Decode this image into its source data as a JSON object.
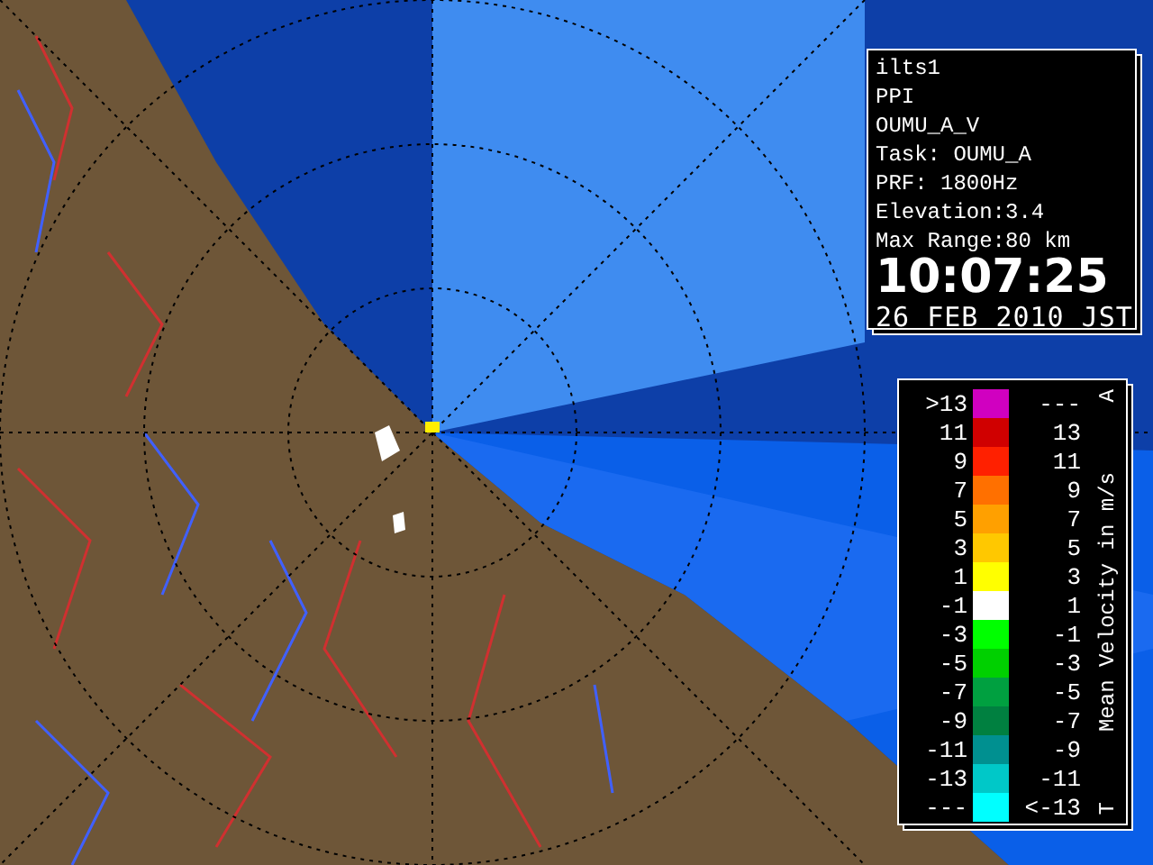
{
  "info": {
    "lines": [
      "ilts1",
      "PPI",
      "OUMU_A_V",
      "Task: OUMU_A",
      "PRF: 1800Hz",
      "Elevation:3.4",
      "Max Range:80 km"
    ],
    "time": "10:07:25",
    "date": "26 FEB 2010 JST"
  },
  "legend": {
    "title": "Mean Velocity in m/s",
    "top_mark": "A",
    "bottom_mark": "T",
    "bins": [
      {
        "low": ">13",
        "high": "---",
        "color": "#d000c0"
      },
      {
        "low": "11",
        "high": "13",
        "color": "#d00000"
      },
      {
        "low": "9",
        "high": "11",
        "color": "#ff2000"
      },
      {
        "low": "7",
        "high": "9",
        "color": "#ff7000"
      },
      {
        "low": "5",
        "high": "7",
        "color": "#ffa000"
      },
      {
        "low": "3",
        "high": "5",
        "color": "#ffc800"
      },
      {
        "low": "1",
        "high": "3",
        "color": "#ffff00"
      },
      {
        "low": "-1",
        "high": "1",
        "color": "#ffffff"
      },
      {
        "low": "-3",
        "high": "-1",
        "color": "#00ff00"
      },
      {
        "low": "-5",
        "high": "-3",
        "color": "#00d000"
      },
      {
        "low": "-7",
        "high": "-5",
        "color": "#00a040"
      },
      {
        "low": "-9",
        "high": "-7",
        "color": "#008040"
      },
      {
        "low": "-11",
        "high": "-9",
        "color": "#009090"
      },
      {
        "low": "-13",
        "high": "-11",
        "color": "#00c8c8"
      },
      {
        "low": "---",
        "high": "<-13",
        "color": "#00ffff"
      }
    ]
  }
}
